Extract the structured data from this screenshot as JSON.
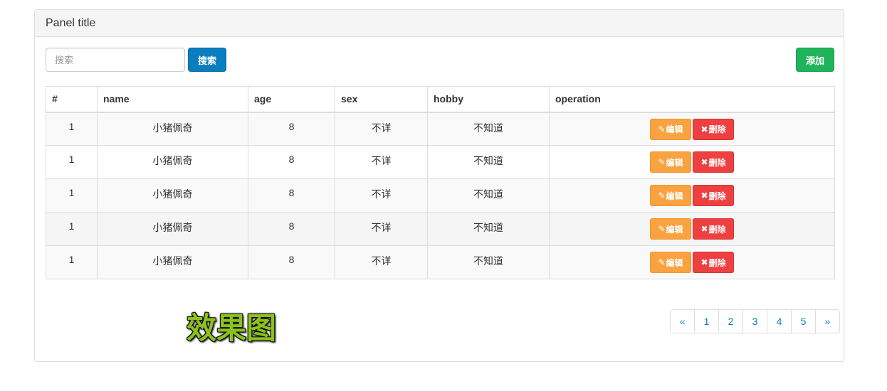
{
  "panel": {
    "title": "Panel title"
  },
  "toolbar": {
    "search_placeholder": "搜索",
    "search_label": "搜索",
    "add_label": "添加"
  },
  "colors": {
    "primary": "#0a7dbf",
    "success": "#1fb45a",
    "warning": "#f9a240",
    "danger": "#ee4040",
    "watermark": "#8cc21a"
  },
  "table": {
    "headers": [
      "#",
      "name",
      "age",
      "sex",
      "hobby",
      "operation"
    ],
    "rows": [
      {
        "id": "1",
        "name": "小猪佩奇",
        "age": "8",
        "sex": "不详",
        "hobby": "不知道"
      },
      {
        "id": "1",
        "name": "小猪佩奇",
        "age": "8",
        "sex": "不详",
        "hobby": "不知道"
      },
      {
        "id": "1",
        "name": "小猪佩奇",
        "age": "8",
        "sex": "不详",
        "hobby": "不知道"
      },
      {
        "id": "1",
        "name": "小猪佩奇",
        "age": "8",
        "sex": "不详",
        "hobby": "不知道"
      },
      {
        "id": "1",
        "name": "小猪佩奇",
        "age": "8",
        "sex": "不详",
        "hobby": "不知道"
      }
    ],
    "edit_label": "编辑",
    "delete_label": "删除",
    "edit_icon": "pencil-icon",
    "delete_icon": "remove-icon"
  },
  "watermark": "效果图",
  "pagination": {
    "prev": "«",
    "pages": [
      "1",
      "2",
      "3",
      "4",
      "5"
    ],
    "next": "»"
  }
}
